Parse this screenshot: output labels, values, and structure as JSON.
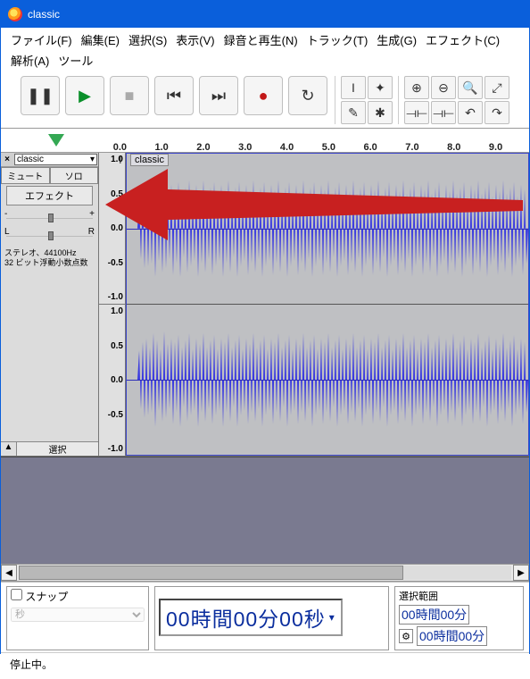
{
  "title": "classic",
  "menu": [
    "ファイル(F)",
    "編集(E)",
    "選択(S)",
    "表示(V)",
    "録音と再生(N)",
    "トラック(T)",
    "生成(G)",
    "エフェクト(C)",
    "解析(A)",
    "ツール"
  ],
  "ruler": {
    "ticks": [
      "0.0",
      "1.0",
      "2.0",
      "3.0",
      "4.0",
      "5.0",
      "6.0",
      "7.0",
      "8.0",
      "9.0"
    ]
  },
  "track": {
    "name": "classic",
    "clip_name": "classic",
    "mute": "ミュート",
    "solo": "ソロ",
    "effect": "エフェクト",
    "info1": "ステレオ、44100Hz",
    "info2": "32 ビット浮動小数点数",
    "select": "選択",
    "amp_labels": [
      "1.0",
      "0.5",
      "0.0",
      "-0.5",
      "-1.0"
    ],
    "pan": {
      "L": "L",
      "R": "R"
    },
    "gain": {
      "minus": "-",
      "plus": "+"
    }
  },
  "snap": {
    "label": "スナップ",
    "unit": "秒"
  },
  "time_display": "00時間00分00秒",
  "selection": {
    "label": "選択範囲",
    "start": "00時間00分",
    "end": "00時間00分"
  },
  "status": "停止中。",
  "icons": {
    "pause": "❚❚",
    "play": "▶",
    "stop": "■",
    "skip_start": "⏮",
    "skip_end": "⏭",
    "record": "●",
    "loop": "↻",
    "ibeam": "I",
    "envelope": "✦",
    "draw": "✎",
    "multi": "✱",
    "zoom_in": "⊕",
    "zoom_out": "⊖",
    "zoom_sel": "🔍",
    "zoom_fit": "⤢",
    "trim": "⟞⟝",
    "silence": "⟞⟝",
    "undo": "↶",
    "redo": "↷",
    "dropdown": "▾",
    "gear": "⚙",
    "left": "◀",
    "right": "▶",
    "collapse": "▲"
  }
}
